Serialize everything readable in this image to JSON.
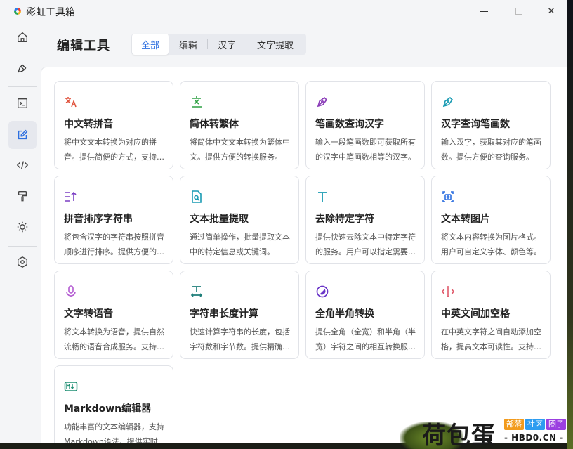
{
  "window": {
    "title": "彩虹工具箱",
    "min_glyph": "—",
    "close_glyph": "✕"
  },
  "sidebar": {
    "items": [
      {
        "name": "home-icon",
        "active": false
      },
      {
        "name": "brush-icon",
        "active": false
      },
      {
        "name": "terminal-icon",
        "active": false
      },
      {
        "name": "edit-icon",
        "active": true
      },
      {
        "name": "code-icon",
        "active": false
      },
      {
        "name": "paint-roller-icon",
        "active": false
      },
      {
        "name": "sun-icon",
        "active": false
      },
      {
        "name": "settings-icon",
        "active": false
      }
    ]
  },
  "header": {
    "title": "编辑工具",
    "tabs": [
      {
        "label": "全部",
        "active": true
      },
      {
        "label": "编辑",
        "active": false
      },
      {
        "label": "汉字",
        "active": false
      },
      {
        "label": "文字提取",
        "active": false
      }
    ]
  },
  "tools": [
    {
      "name": "中文转拼音",
      "desc": "将中文文本转换为对应的拼音。提供简便的方式，支持多种拼音风格。",
      "icon": "translate-icon",
      "color": "#e0533d"
    },
    {
      "name": "简体转繁体",
      "desc": "将简体中文文本转换为繁体中文。提供方便的转换服务。",
      "icon": "text-convert-icon",
      "color": "#2ea043"
    },
    {
      "name": "笔画数查询汉字",
      "desc": "输入一段笔画数即可获取所有的汉字中笔画数相等的汉字。",
      "icon": "pen-tool-icon",
      "color": "#8a3bb8"
    },
    {
      "name": "汉字查询笔画数",
      "desc": "输入汉字，获取其对应的笔画数。提供方便的查询服务。",
      "icon": "pen-tool-icon",
      "color": "#1a9bb3"
    },
    {
      "name": "拼音排序字符串",
      "desc": "将包含汉字的字符串按照拼音顺序进行排序。提供方便的排序功能。",
      "icon": "sort-icon",
      "color": "#7b3fc4"
    },
    {
      "name": "文本批量提取",
      "desc": "通过简单操作，批量提取文本中的特定信息或关键词。",
      "icon": "file-search-icon",
      "color": "#1a9bb3"
    },
    {
      "name": "去除特定字符",
      "desc": "提供快速去除文本中特定字符的服务。用户可以指定需要去除的字符。",
      "icon": "text-t-icon",
      "color": "#1a9bb3"
    },
    {
      "name": "文本转图片",
      "desc": "将文本内容转换为图片格式。用户可自定义字体、颜色等。",
      "icon": "image-text-icon",
      "color": "#2d6fe0"
    },
    {
      "name": "文字转语音",
      "desc": "将文本转换为语音，提供自然流畅的语音合成服务。支持多种音色。",
      "icon": "microphone-icon",
      "color": "#b35ad1"
    },
    {
      "name": "字符串长度计算",
      "desc": "快速计算字符串的长度，包括字符数和字节数。提供精确统计。",
      "icon": "text-width-icon",
      "color": "#1f7f7a"
    },
    {
      "name": "全角半角转换",
      "desc": "提供全角（全宽）和半角（半宽）字符之间的相互转换服务。",
      "icon": "contrast-icon",
      "color": "#6a35c8"
    },
    {
      "name": "中英文间加空格",
      "desc": "在中英文字符之间自动添加空格，提高文本可读性。支持批量处理。",
      "icon": "cursor-text-icon",
      "color": "#e05a6b"
    },
    {
      "name": "Markdown编辑器",
      "desc": "功能丰富的文本编辑器，支持Markdown语法。提供实时预览。",
      "icon": "markdown-icon",
      "color": "#1f8f73"
    }
  ],
  "watermark": {
    "brand": "荷包蛋",
    "tags": [
      {
        "label": "部落",
        "color": "#f29b1d"
      },
      {
        "label": "社区",
        "color": "#2d9cf0"
      },
      {
        "label": "圈子",
        "color": "#9b3fe0"
      }
    ],
    "url": "- HBD0.CN -"
  }
}
